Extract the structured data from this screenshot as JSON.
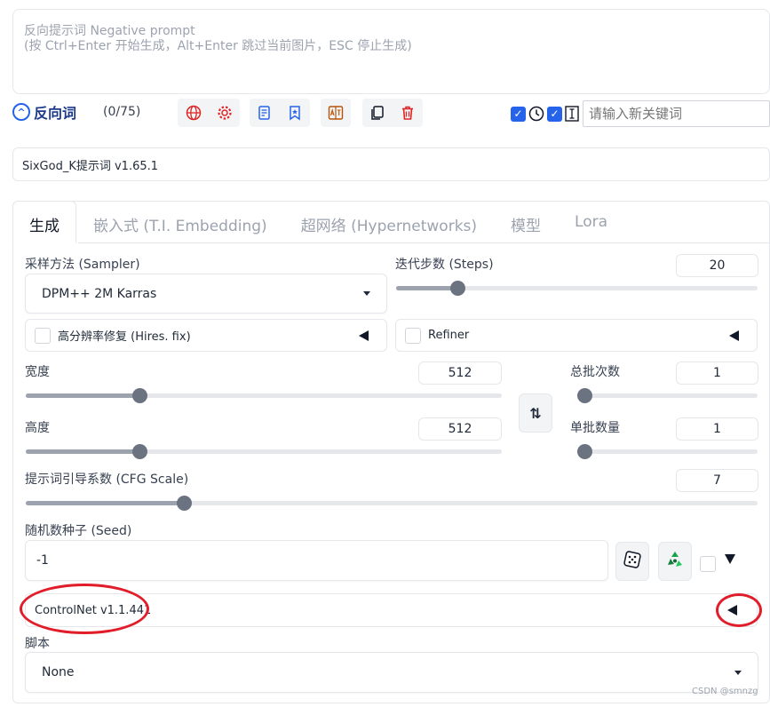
{
  "negative_prompt": {
    "placeholder_line1": "反向提示词 Negative prompt",
    "placeholder_line2": "(按 Ctrl+Enter 开始生成，Alt+Enter 跳过当前图片，ESC 停止生成)",
    "title": "反向词",
    "count": "(0/75)",
    "keyword_placeholder": "请输入新关键词"
  },
  "sixgod": {
    "label": "SixGod_K提示词 v1.65.1"
  },
  "tabs": [
    {
      "label": "生成"
    },
    {
      "label": "嵌入式 (T.I. Embedding)"
    },
    {
      "label": "超网络 (Hypernetworks)"
    },
    {
      "label": "模型"
    },
    {
      "label": "Lora"
    }
  ],
  "sampler": {
    "label": "采样方法 (Sampler)",
    "value": "DPM++ 2M Karras"
  },
  "steps": {
    "label": "迭代步数 (Steps)",
    "value": "20",
    "fraction": 0.157
  },
  "hires": {
    "label": "高分辨率修复 (Hires. fix)"
  },
  "refiner": {
    "label": "Refiner"
  },
  "width": {
    "label": "宽度",
    "value": "512",
    "fraction": 0.23
  },
  "height": {
    "label": "高度",
    "value": "512",
    "fraction": 0.23
  },
  "batch_count": {
    "label": "总批次数",
    "value": "1",
    "fraction": 0.0
  },
  "batch_size": {
    "label": "单批数量",
    "value": "1",
    "fraction": 0.0
  },
  "cfg": {
    "label": "提示词引导系数 (CFG Scale)",
    "value": "7",
    "fraction": 0.21
  },
  "seed": {
    "label": "随机数种子 (Seed)",
    "value": "-1"
  },
  "controlnet": {
    "label": "ControlNet v1.1.441"
  },
  "script": {
    "label": "脚本",
    "value": "None"
  },
  "watermark": "CSDN @smnzg",
  "colors": {
    "accent": "#2563eb",
    "annotation": "#e11d2a"
  }
}
